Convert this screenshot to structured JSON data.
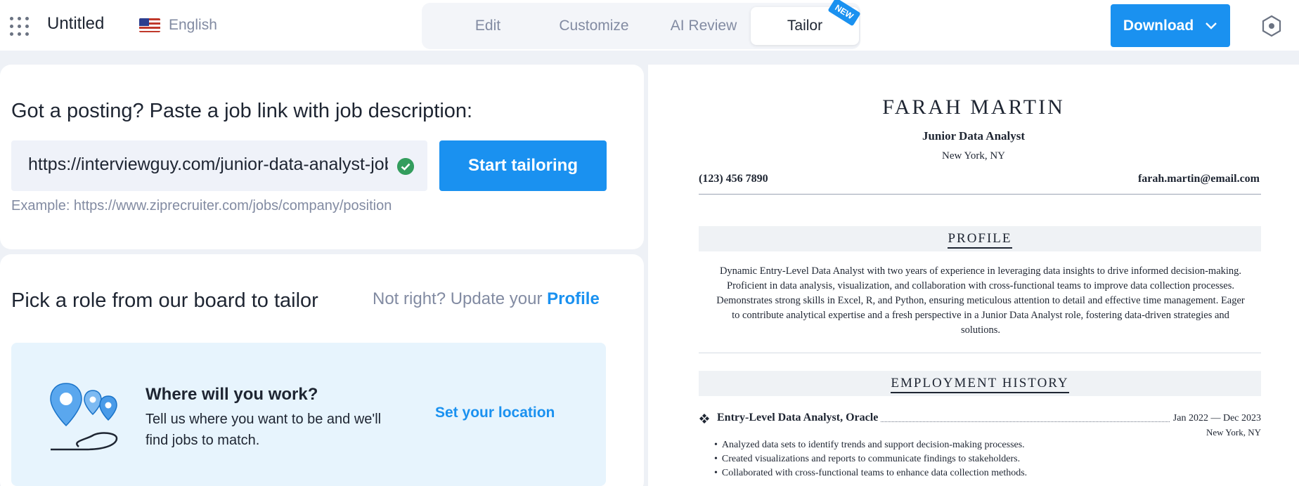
{
  "header": {
    "doc_title": "Untitled",
    "language": "English",
    "tabs": [
      {
        "label": "Edit"
      },
      {
        "label": "Customize"
      },
      {
        "label": "AI Review"
      },
      {
        "label": "Tailor",
        "active": true
      }
    ],
    "new_badge": "NEW",
    "download_label": "Download",
    "accent_color": "#1a91f0"
  },
  "posting": {
    "heading": "Got a posting? Paste a job link with job description:",
    "link_value": "https://interviewguy.com/junior-data-analyst-job-description/",
    "start_label": "Start tailoring",
    "example": "Example: https://www.ziprecruiter.com/jobs/company/position"
  },
  "role_board": {
    "heading": "Pick a role from our board to tailor",
    "not_right_prefix": "Not right? Update your",
    "profile_link": "Profile",
    "location_title": "Where will you work?",
    "location_desc": "Tell us where you want to be and we'll find jobs to match.",
    "location_link": "Set your location"
  },
  "resume": {
    "name": "FARAH MARTIN",
    "role": "Junior Data Analyst",
    "city": "New York, NY",
    "phone": "(123) 456 7890",
    "email": "farah.martin@email.com",
    "profile_heading": "PROFILE",
    "profile_text": "Dynamic Entry-Level Data Analyst with two years of experience in leveraging data insights to drive informed decision-making. Proficient in data analysis, visualization, and collaboration with cross-functional teams to improve data collection processes. Demonstrates strong skills in Excel, R, and Python, ensuring meticulous attention to detail and effective time management. Eager to contribute analytical expertise and a fresh perspective in a Junior Data Analyst role, fostering data-driven strategies and solutions.",
    "employment_heading": "EMPLOYMENT HISTORY",
    "job": {
      "title": "Entry-Level Data Analyst, Oracle",
      "dates": "Jan 2022 — Dec 2023",
      "location": "New York, NY",
      "bullets": [
        "Analyzed data sets to identify trends and support decision-making processes.",
        "Created visualizations and reports to communicate findings to stakeholders.",
        "Collaborated with cross-functional teams to enhance data collection methods."
      ]
    }
  }
}
